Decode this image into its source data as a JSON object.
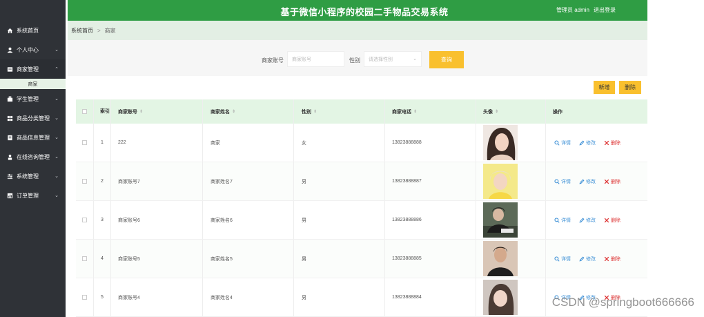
{
  "sidebar": {
    "items": [
      {
        "label": "系统首页",
        "icon": "home-icon",
        "chevron": false
      },
      {
        "label": "个人中心",
        "icon": "user-icon",
        "chevron": true
      },
      {
        "label": "商家管理",
        "icon": "store-icon",
        "chevron": true,
        "open": true
      },
      {
        "label": "学生管理",
        "icon": "bag-icon",
        "chevron": true
      },
      {
        "label": "商品分类管理",
        "icon": "grid-icon",
        "chevron": true
      },
      {
        "label": "商品信息管理",
        "icon": "doc-icon",
        "chevron": true
      },
      {
        "label": "在线咨询管理",
        "icon": "person-icon",
        "chevron": true
      },
      {
        "label": "系统管理",
        "icon": "sliders-icon",
        "chevron": true
      },
      {
        "label": "订单管理",
        "icon": "chart-icon",
        "chevron": true
      }
    ],
    "submenu": "商家"
  },
  "header": {
    "title": "基于微信小程序的校园二手物品交易系统",
    "user": "管理员 admin",
    "logout": "退出登录"
  },
  "breadcrumb": {
    "home": "系统首页",
    "separator": ">",
    "current": "商家"
  },
  "search": {
    "account_label": "商家账号",
    "account_placeholder": "商家账号",
    "gender_label": "性别",
    "gender_placeholder": "请选择性别",
    "query_button": "查询"
  },
  "actions": {
    "add": "新增",
    "delete": "删除"
  },
  "table": {
    "headers": {
      "index": "索引",
      "account": "商家账号",
      "name": "商家姓名",
      "gender": "性别",
      "phone": "商家电话",
      "avatar": "头像",
      "ops": "操作"
    },
    "ops": {
      "detail": "详情",
      "edit": "修改",
      "delete": "删除"
    },
    "rows": [
      {
        "index": "1",
        "account": "222",
        "name": "商家",
        "gender": "女",
        "phone": "13823888888"
      },
      {
        "index": "2",
        "account": "商家账号7",
        "name": "商家姓名7",
        "gender": "男",
        "phone": "13823888887"
      },
      {
        "index": "3",
        "account": "商家账号6",
        "name": "商家姓名6",
        "gender": "男",
        "phone": "13823888886"
      },
      {
        "index": "4",
        "account": "商家账号5",
        "name": "商家姓名5",
        "gender": "男",
        "phone": "13823888885"
      },
      {
        "index": "5",
        "account": "商家账号4",
        "name": "商家姓名4",
        "gender": "男",
        "phone": "13823888884"
      }
    ]
  },
  "watermark": "CSDN @springboot666666",
  "colors": {
    "header": "#2f9d44",
    "sidebar": "#2f3237",
    "accent": "#f9c02e",
    "link": "#3b8fd6",
    "danger": "#dd3333"
  }
}
